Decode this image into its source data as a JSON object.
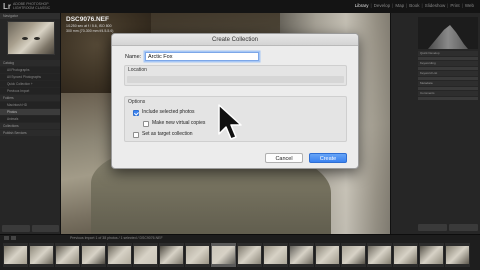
{
  "app": {
    "brand_line1": "ADOBE PHOTOSHOP",
    "brand_line2": "LIGHTROOM CLASSIC",
    "logo": "Lr",
    "modules": [
      "Library",
      "Develop",
      "Map",
      "Book",
      "Slideshow",
      "Print",
      "Web"
    ],
    "active_module": "Library"
  },
  "left_panel": {
    "navigator_header": "Navigator",
    "rows": [
      {
        "label": "Catalog",
        "kind": "header"
      },
      {
        "label": "All Photographs",
        "kind": "sub"
      },
      {
        "label": "All Synced Photographs",
        "kind": "sub"
      },
      {
        "label": "Quick Collection +",
        "kind": "sub"
      },
      {
        "label": "Previous Import",
        "kind": "sub"
      },
      {
        "label": "Folders",
        "kind": "header"
      },
      {
        "label": "Macintosh HD",
        "kind": "sub"
      },
      {
        "label": "Photos",
        "kind": "hl"
      },
      {
        "label": "Animals",
        "kind": "sub"
      },
      {
        "label": "Collections",
        "kind": "header"
      },
      {
        "label": "Publish Services",
        "kind": "header"
      }
    ]
  },
  "image": {
    "filename": "DSC9076.NEF",
    "meta_line1": "1/1250 sec at f / 5.6, ISO 800",
    "meta_line2": "300 mm (70-300 mm f/4.5-5.6)"
  },
  "right_panel": {
    "rows": [
      "Quick Develop",
      "Keywording",
      "Keyword List",
      "Metadata",
      "Comments"
    ]
  },
  "toolbar": {
    "info": "Previous Import   1 of 38 photos / 1 selected / DSC9076.NEF"
  },
  "dialog": {
    "title": "Create Collection",
    "name_label": "Name:",
    "name_value": "Arctic Fox",
    "location_label": "Location",
    "options_label": "Options",
    "options": [
      {
        "label": "Include selected photos",
        "checked": true
      },
      {
        "label": "Make new virtual copies",
        "checked": false
      },
      {
        "label": "Set as target collection",
        "checked": false
      }
    ],
    "cancel_label": "Cancel",
    "create_label": "Create"
  },
  "filmstrip": {
    "count": 18,
    "selected_index": 8
  },
  "colors": {
    "accent": "#3b83f1",
    "panel_bg": "#262626"
  }
}
